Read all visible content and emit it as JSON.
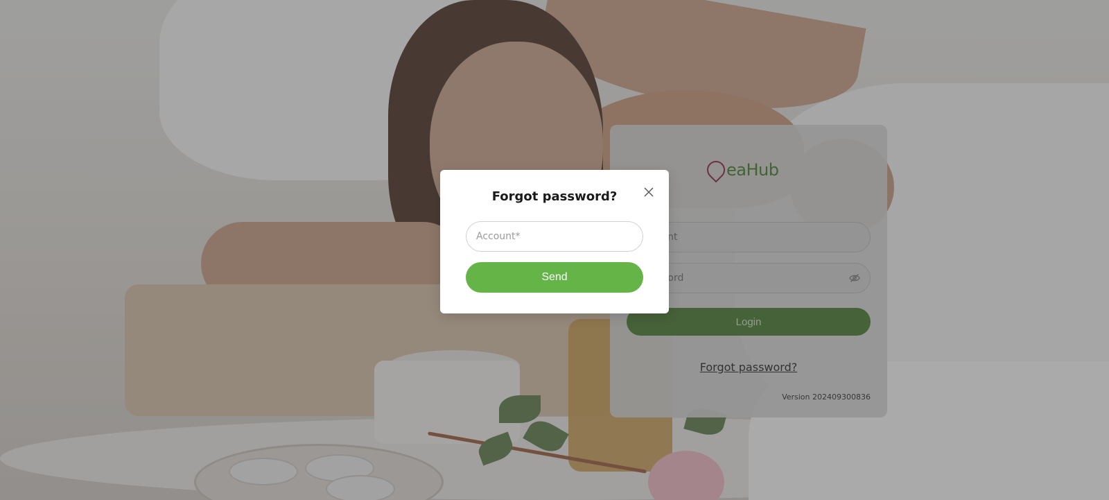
{
  "login": {
    "logo_text": "eaHub",
    "account_placeholder": "Account",
    "password_placeholder": "Password",
    "login_label": "Login",
    "forgot_label": "Forgot password?",
    "version": "Version 202409300836"
  },
  "modal": {
    "title": "Forgot password?",
    "account_placeholder": "Account*",
    "send_label": "Send"
  },
  "icons": {
    "close": "close-icon",
    "eye": "eye-off-icon",
    "logo": "logo-icon"
  },
  "colors": {
    "brand_green": "#64b448",
    "login_green": "#45792e",
    "logo_red": "#8a1f3d",
    "logo_green": "#3f7a24"
  }
}
